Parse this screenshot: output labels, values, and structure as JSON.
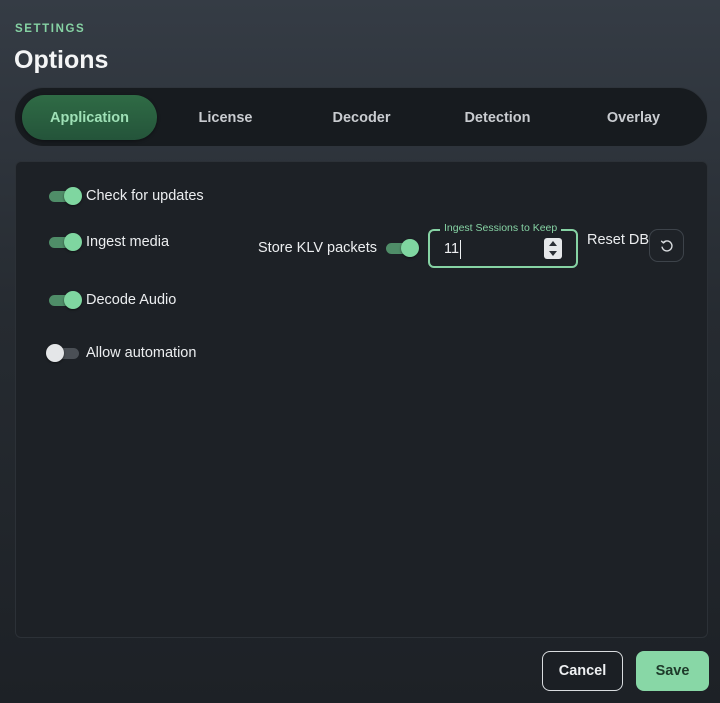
{
  "header": {
    "kicker": "SETTINGS",
    "title": "Options"
  },
  "tabs": [
    {
      "label": "Application",
      "active": true
    },
    {
      "label": "License",
      "active": false
    },
    {
      "label": "Decoder",
      "active": false
    },
    {
      "label": "Detection",
      "active": false
    },
    {
      "label": "Overlay",
      "active": false
    }
  ],
  "settings": {
    "check_updates": {
      "label": "Check for updates",
      "on": true
    },
    "ingest_media": {
      "label": "Ingest media",
      "on": true
    },
    "decode_audio": {
      "label": "Decode Audio",
      "on": true
    },
    "allow_automation": {
      "label": "Allow automation",
      "on": false
    },
    "store_klv": {
      "label": "Store KLV packets",
      "on": true
    },
    "ingest_sessions": {
      "label": "Ingest Sessions to Keep",
      "value": "11"
    },
    "reset_db": {
      "label": "Reset DB",
      "icon": "refresh-icon"
    }
  },
  "footer": {
    "cancel_label": "Cancel",
    "save_label": "Save"
  },
  "colors": {
    "accent": "#86d3a4",
    "tab_active": "#2f6b45",
    "save_bg": "#88d7a6"
  }
}
